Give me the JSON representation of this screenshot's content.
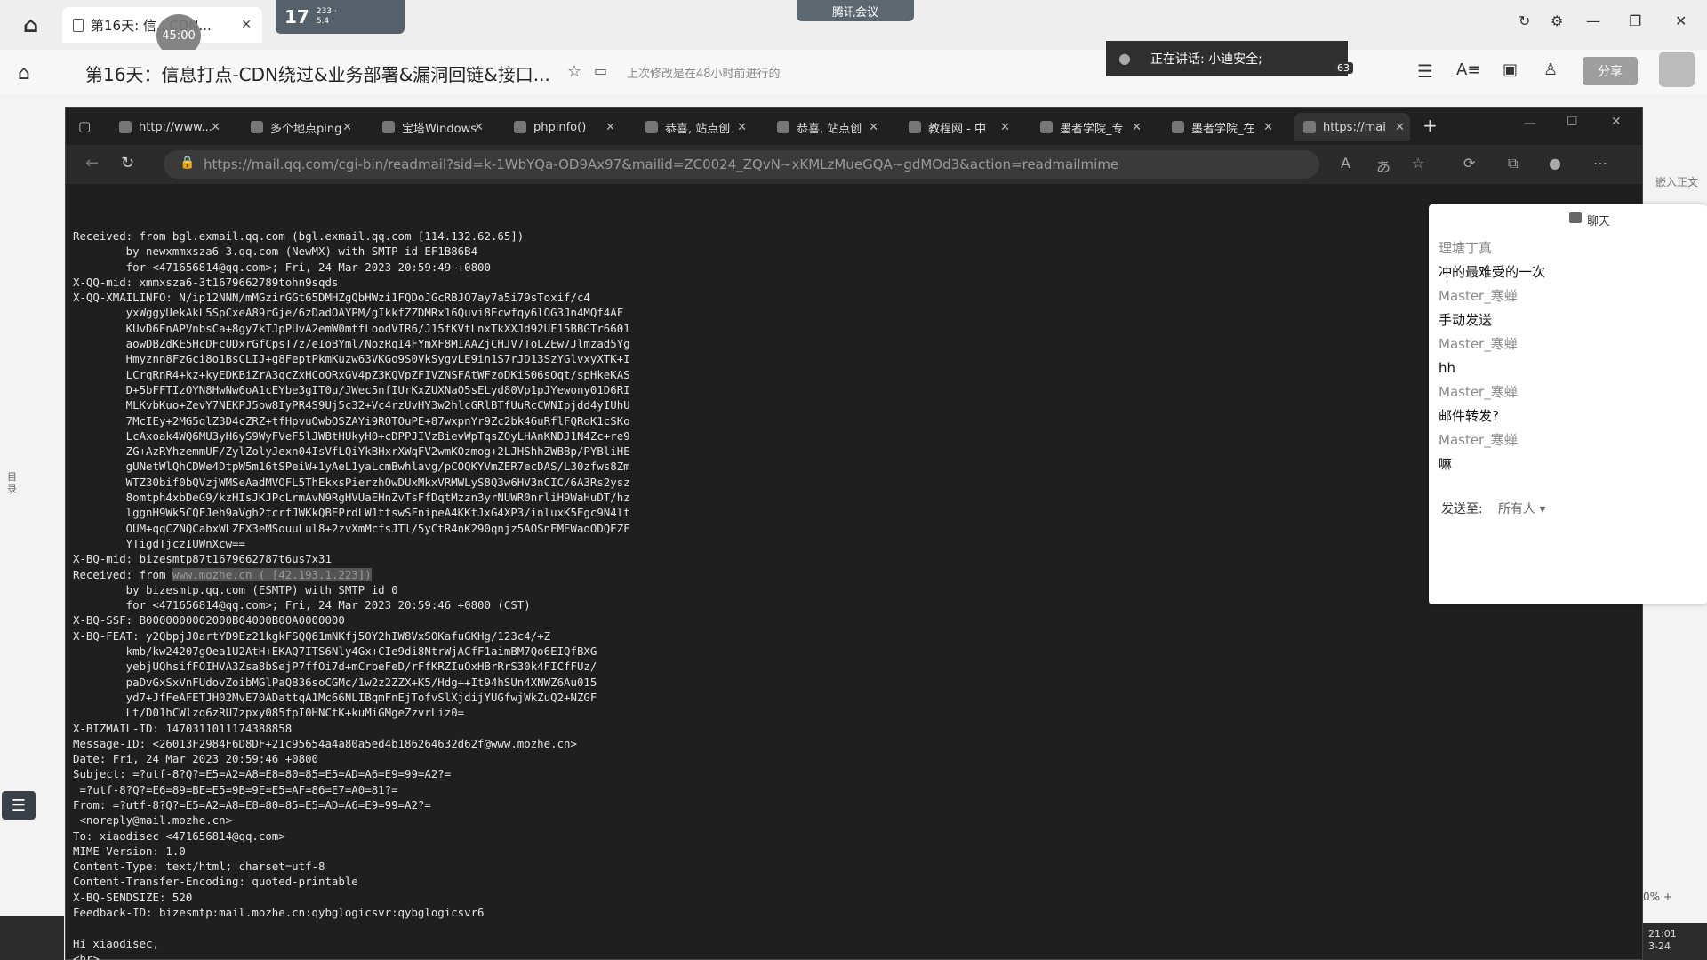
{
  "outer_browser": {
    "tab_title": "第16天: 信...CDN...",
    "timer": "45:00",
    "weather_num": "17",
    "weather_sub1": "233 ·",
    "weather_sub2": "5.4 ·",
    "meeting_label": "腾讯会议",
    "page_title": "第16天：信息打点-CDN绕过&业务部署&漏洞回链&接口...",
    "status_text": "上次修改是在48小时前进行的",
    "speaking_text": "正在讲话: 小迪安全;",
    "participant_count": "63",
    "share_label": "分享"
  },
  "inner_browser": {
    "tabs": [
      {
        "label": "http://www..."
      },
      {
        "label": "多个地点ping"
      },
      {
        "label": "宝塔Windows"
      },
      {
        "label": "phpinfo()"
      },
      {
        "label": "恭喜, 站点创"
      },
      {
        "label": "恭喜, 站点创"
      },
      {
        "label": "教程网 - 中"
      },
      {
        "label": "墨者学院_专"
      },
      {
        "label": "墨者学院_在"
      },
      {
        "label": "https://mai"
      }
    ],
    "url": "https://mail.qq.com/cgi-bin/readmail?sid=k-1WbYQa-OD9Ax97&mailid=ZC0024_ZQvN~xKMLzMueGQA~gdMOd3&action=readmailmime"
  },
  "email_raw": [
    "Received: from bgl.exmail.qq.com (bgl.exmail.qq.com [114.132.62.65])",
    "        by newxmmxsza6-3.qq.com (NewMX) with SMTP id EF1B86B4",
    "        for <471656814@qq.com>; Fri, 24 Mar 2023 20:59:49 +0800",
    "X-QQ-mid: xmmxsza6-3t1679662789tohn9sqds",
    "X-QQ-XMAILINFO: N/ip12NNN/mMGzirGGt65DMHZgQbHWzi1FQDoJGcRBJO7ay7a5i79sToxif/c4",
    "        yxWggyUekAkL5SpCxeA89rGje/6zDadOAYPM/gIkkfZZDMRx16Quvi8Ecwfqy6lOG3Jn4MQf4AF",
    "        KUvD6EnAPVnbsCa+8gy7kTJpPUvA2emW0mtfLoodVIR6/J15fKVtLnxTkXXJd92UF15BBGTr6601",
    "        aowDBZdKE5HcDFcUDxrGfCpsT7z/eIoBYml/NozRqI4FYmXF8MIAAZjCHJV7ToLZEw7Jlmzad5Yg",
    "        Hmyznn8FzGci8o1BsCLIJ+g8FeptPkmKuzw63VKGo9S0VkSygvLE9in1S7rJD13SzYGlvxyXTK+I",
    "        LCrqRnR4+kz+kyEDKBiZrA3qcZxHCoORxGV4pZ3KQVpZFIVZNSFAtWFzoDKiS06sOqt/spHkeKAS",
    "        D+5bFFTIzOYN8HwNw6oA1cEYbe3gIT0u/JWec5nfIUrKxZUXNaO5sELyd80Vp1pJYewony01D6RI",
    "        MLKvbKuo+ZevY7NEKPJ5ow8IyPR4S9Uj5c32+Vc4rzUvHY3w2hlcGRlBTfUuRcCWNIpjdd4yIUhU",
    "        7McIEy+2MG5qlZ3D4cZRZ+tfHpvuOwbOSZAYi9ROTOuPE+87wxpnYr9Zc2bk46uRflFQRoK1cSKo",
    "        LcAxoak4WQ6MU3yH6yS9WyFVeF5lJWBtHUkyH0+cDPPJIVzBievWpTqsZOyLHAnKNDJ1N4Zc+re9",
    "        ZG+AzRYhzemmUF/ZylZolyJexn04IsVfLQiYkBHxrXWqFV2wmKOzmog+2LJHShhZWBBp/PYBliHE",
    "        gUNetWlQhCDWe4DtpW5m16tSPeiW+1yAeL1yaLcmBwhlavg/pCOQKYVmZER7ecDAS/L30zfws8Zm",
    "        WTZ30bif0bQVzjWMSeAadMVOFL5ThEkxsPierzhOwDUxMkxVRMWLyS8Q3w6HV3nCIC/6A3Rs2ysz",
    "        8omtph4xbDeG9/kzHIsJKJPcLrmAvN9RgHVUaEHnZvTsFfDqtMzzn3yrNUWR0nrliH9WaHuDT/hz",
    "        lggnH9Wk5CQFJeh9aVgh2tcrfJWKkQBEPrdLW1ttswSFnipeA4KKtJxG4XP3/inluxK5Egc9N4lt",
    "        OUM+qqCZNQCabxWLZEX3eMSouuLul8+2zvXmMcfsJTl/5yCtR4nK290qnjz5AOSnEMEWaoODQEZF",
    "        YTigdTjczIUWnXcw==",
    "X-BQ-mid: bizesmtp87t1679662787t6us7x31",
    "Received: from www.mozhe.cn ( [42.193.1.223])",
    "        by bizesmtp.qq.com (ESMTP) with SMTP id 0",
    "        for <471656814@qq.com>; Fri, 24 Mar 2023 20:59:46 +0800 (CST)",
    "X-BQ-SSF: B0000000002000B04000B00A0000000",
    "X-BQ-FEAT: y2QbpjJ0artYD9Ez21kgkFSQQ61mNKfj5OY2hIW8VxSOKafuGKHg/123c4/+Z",
    "        kmb/kw24207gOea1U2AtH+EKAQ7ITS6Nly4Gx+CIe9di8NtrWjACfF1aimBM7Qo6EIQfBXG",
    "        yebjUQhsifFOIHVA3Zsa8bSejP7ffOi7d+mCrbeFeD/rFfKRZIuOxHBrRrS30k4FICfFUz/",
    "        paDvGxSxVnFUdovZoibMGlPaQB36soCGMc/1w2z2ZZX+K5/Hdg++It94hSUn4XNWZ6Au015",
    "        yd7+JfFeAFETJH02MvE70ADattqA1Mc66NLIBqmFnEjTofvSlXjdijYUGfwjWkZuQ2+NZGF",
    "        Lt/D01hCWlzq6zRU7zpxy085fpI0HNCtK+kuMiGMgeZzvrLiz0=",
    "X-BIZMAIL-ID: 1470311011174388858",
    "Message-ID: <26013F2984F6D8DF+21c95654a4a80a5ed4b186264632d62f@www.mozhe.cn>",
    "Date: Fri, 24 Mar 2023 20:59:46 +0800",
    "Subject: =?utf-8?Q?=E5=A2=A8=E8=80=85=E5=AD=A6=E9=99=A2?=",
    " =?utf-8?Q?=E6=89=BE=E5=9B=9E=E5=AF=86=E7=A0=81?=",
    "From: =?utf-8?Q?=E5=A2=A8=E8=80=85=E5=AD=A6=E9=99=A2?=",
    " <noreply@mail.mozhe.cn>",
    "To: xiaodisec <471656814@qq.com>",
    "MIME-Version: 1.0",
    "Content-Type: text/html; charset=utf-8",
    "Content-Transfer-Encoding: quoted-printable",
    "X-BQ-SENDSIZE: 520",
    "Feedback-ID: bizesmtp:mail.mozhe.cn:qybglogicsvr:qybglogicsvr6",
    "",
    "Hi xiaodisec,",
    "<hr>"
  ],
  "received_highlight": "www.mozhe.cn ( [42.193.1.223])",
  "chat": {
    "title": "聊天",
    "messages": [
      {
        "kind": "name",
        "text": "理塘丁真"
      },
      {
        "kind": "text",
        "text": "冲的最难受的一次"
      },
      {
        "kind": "name",
        "text": "Master_寒蝉"
      },
      {
        "kind": "text",
        "text": "手动发送"
      },
      {
        "kind": "name",
        "text": "Master_寒蝉"
      },
      {
        "kind": "text",
        "text": "hh"
      },
      {
        "kind": "name",
        "text": "Master_寒蝉"
      },
      {
        "kind": "text",
        "text": "邮件转发?"
      },
      {
        "kind": "name",
        "text": "Master_寒蝉"
      },
      {
        "kind": "text",
        "text": "嘛"
      }
    ],
    "send_to_label": "发送至:",
    "send_to_value": "所有人 ▾"
  },
  "side": {
    "left_label": "目录",
    "embed_label": "嵌入正文",
    "zoom": "0%  +",
    "clock_time": "21:01",
    "clock_date": "3-24"
  }
}
